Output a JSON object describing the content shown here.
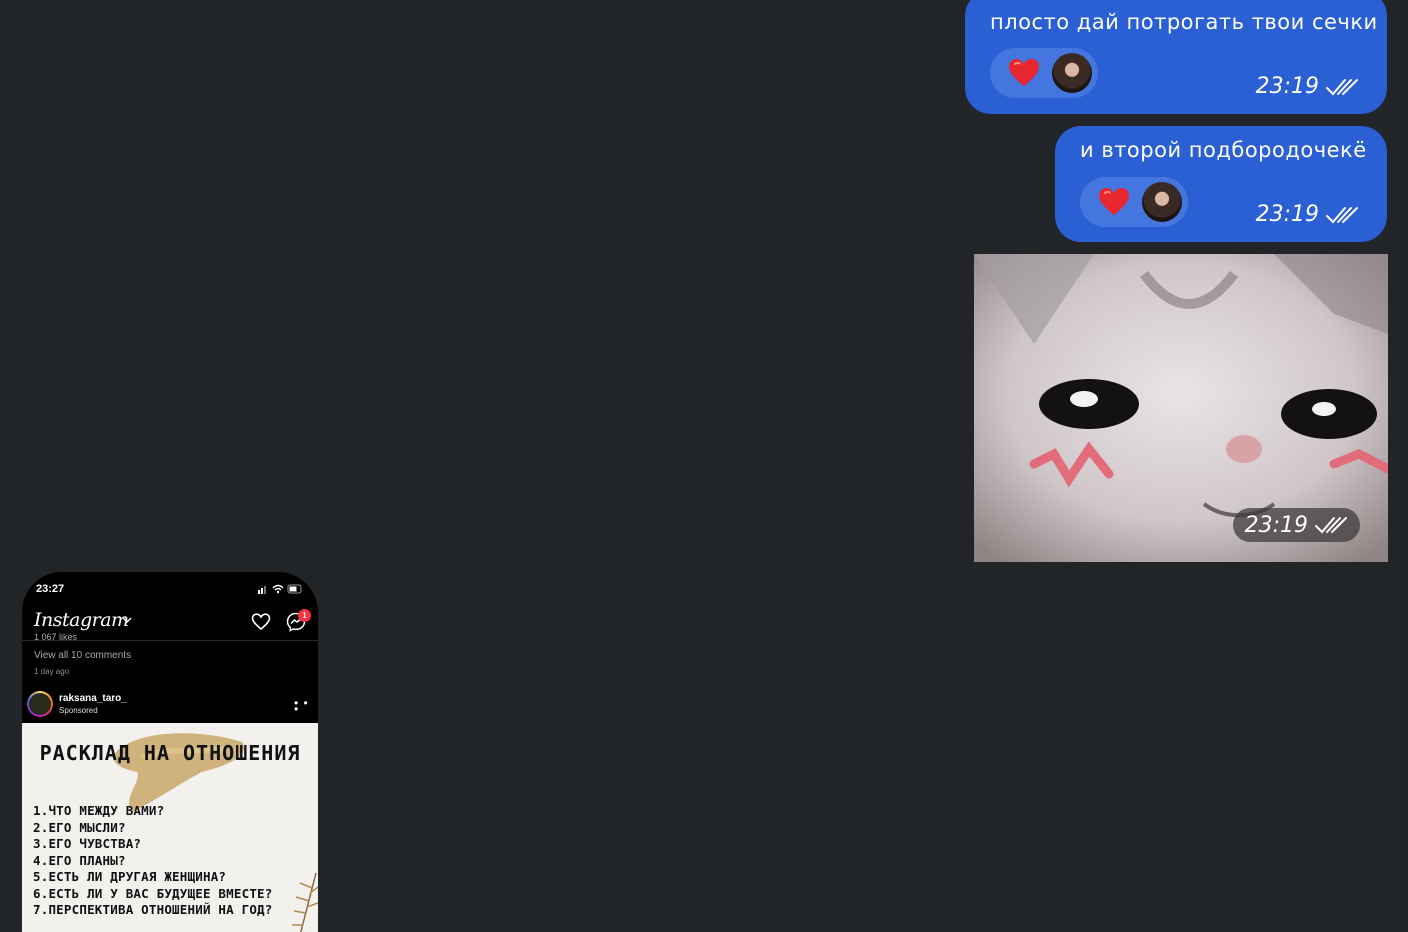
{
  "messages": [
    {
      "text": "плосто дай потрогать твои сечки",
      "time": "23:19",
      "reaction": "heart-icon"
    },
    {
      "text": "и второй подбородочекё",
      "time": "23:19",
      "reaction": "heart-icon"
    }
  ],
  "photo_message": {
    "time": "23:19"
  },
  "colors": {
    "bubble": "#2b5fd4",
    "background": "#222528",
    "reaction_pill": "#4576df"
  },
  "attachment": {
    "status_time": "23:27",
    "app_name": "Instagram",
    "likes_peek": "1 067 likes",
    "dm_badge": "1",
    "view_comments": "View all 10 comments",
    "time_ago": "1 day ago",
    "post_user": "raksana_taro_",
    "post_sponsored": "Sponsored",
    "post_title": "РАСКЛАД НА ОТНОШЕНИЯ",
    "post_lines": [
      "1.ЧТО МЕЖДУ ВАМИ?",
      "2.ЕГО МЫСЛИ?",
      "3.ЕГО ЧУВСТВА?",
      "4.ЕГО ПЛАНЫ?",
      "5.ЕСТЬ ЛИ ДРУГАЯ ЖЕНЩИНА?",
      "6.ЕСТЬ ЛИ У ВАС БУДУЩЕЕ ВМЕСТЕ?",
      "7.ПЕРСПЕКТИВА ОТНОШЕНИЙ НА ГОД?"
    ]
  }
}
